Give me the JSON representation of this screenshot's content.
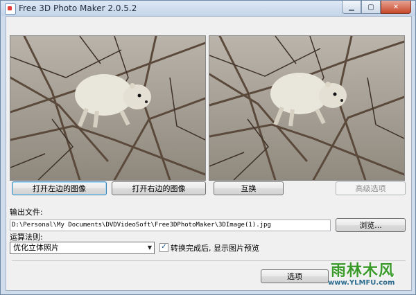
{
  "window": {
    "title": "Free 3D Photo Maker 2.0.5.2"
  },
  "titlebar": {
    "minimize": "▁",
    "maximize": "▢",
    "close": "✕"
  },
  "buttons": {
    "open_left": "打开左边的图像",
    "open_right": "打开右边的图像",
    "swap": "互换",
    "advanced": "高级选项",
    "browse": "浏览...",
    "options": "选项"
  },
  "output": {
    "label": "输出文件:",
    "path": "D:\\Personal\\My Documents\\DVDVideoSoft\\Free3DPhotoMaker\\3DImage(1).jpg"
  },
  "algorithm": {
    "label": "运算法则:",
    "selected": "优化立体照片"
  },
  "preview_checkbox": {
    "checked": true,
    "label": "转换完成后, 显示图片预览"
  },
  "watermark": {
    "text": "雨林木风",
    "url": "www.YLMFU.com"
  },
  "colors": {
    "client_bg": "#f0f0f0",
    "frame": "#cfdcec",
    "close": "#c7482b",
    "watermark": "#3a9a2a"
  }
}
